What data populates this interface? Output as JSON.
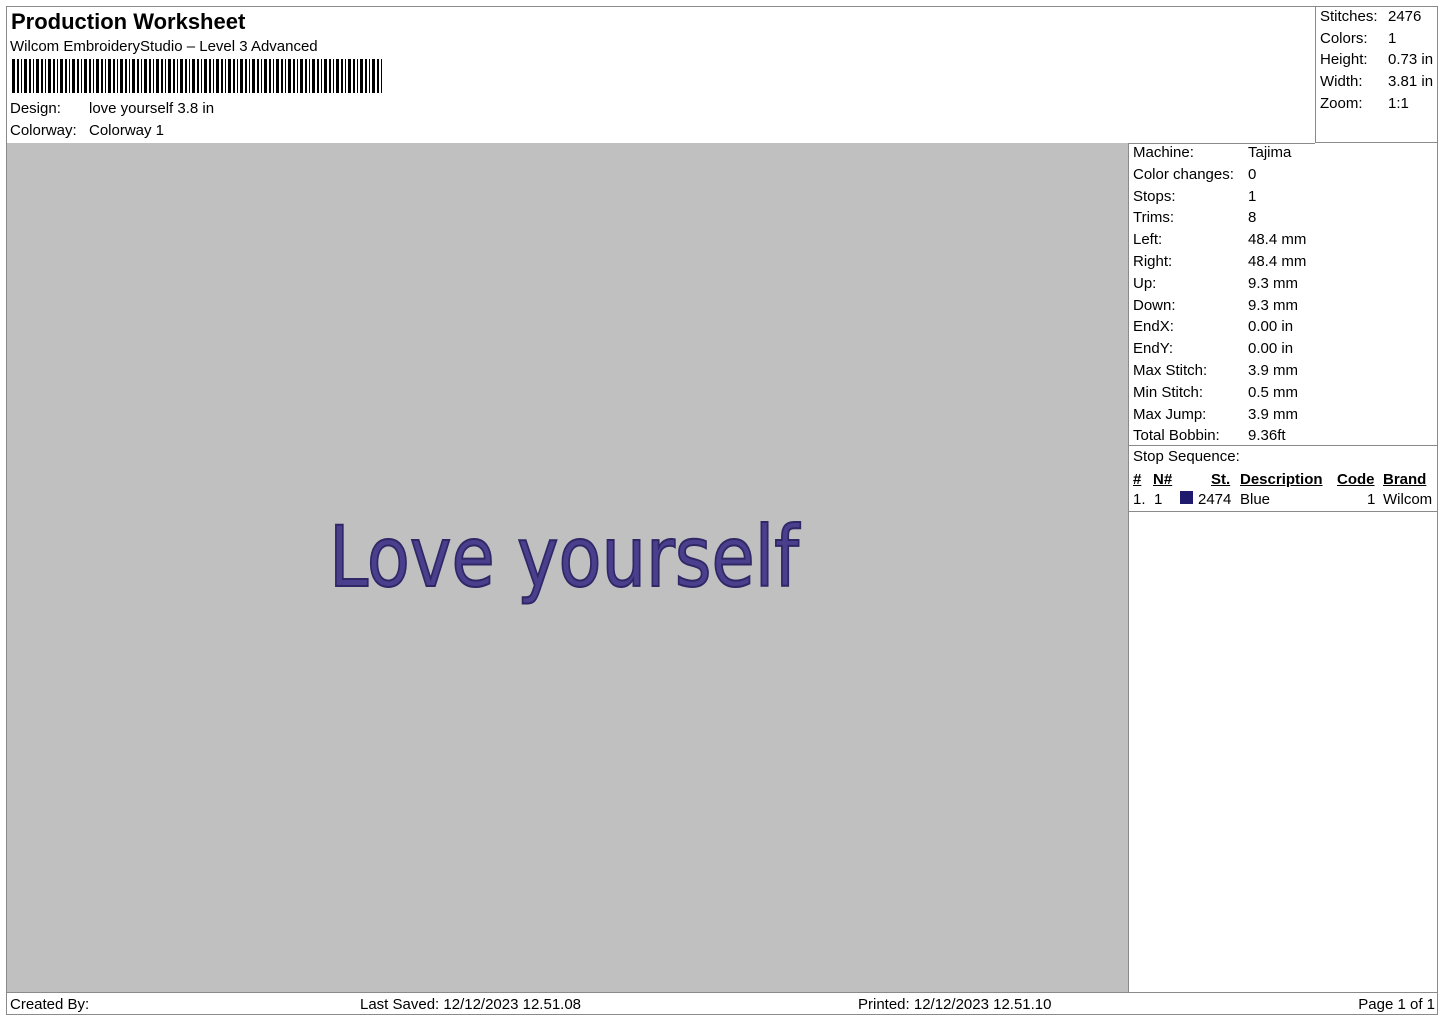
{
  "header": {
    "title": "Production Worksheet",
    "subtitle": "Wilcom EmbroideryStudio – Level 3 Advanced",
    "design_label": "Design:",
    "design_value": "love yourself 3.8 in",
    "colorway_label": "Colorway:",
    "colorway_value": "Colorway 1"
  },
  "summary": {
    "stitches_label": "Stitches:",
    "stitches_value": "2476",
    "colors_label": "Colors:",
    "colors_value": "1",
    "height_label": "Height:",
    "height_value": "0.73 in",
    "width_label": "Width:",
    "width_value": "3.81 in",
    "zoom_label": "Zoom:",
    "zoom_value": "1:1"
  },
  "properties": [
    {
      "label": "Machine:",
      "value": "Tajima"
    },
    {
      "label": "Color changes:",
      "value": "0"
    },
    {
      "label": "Stops:",
      "value": "1"
    },
    {
      "label": "Trims:",
      "value": "8"
    },
    {
      "label": "Left:",
      "value": "48.4 mm"
    },
    {
      "label": "Right:",
      "value": "48.4 mm"
    },
    {
      "label": "Up:",
      "value": "9.3 mm"
    },
    {
      "label": "Down:",
      "value": "9.3 mm"
    },
    {
      "label": "EndX:",
      "value": "0.00 in"
    },
    {
      "label": "EndY:",
      "value": "0.00 in"
    },
    {
      "label": "Max Stitch:",
      "value": "3.9 mm"
    },
    {
      "label": "Min Stitch:",
      "value": "0.5 mm"
    },
    {
      "label": "Max Jump:",
      "value": "3.9 mm"
    },
    {
      "label": "Total Bobbin:",
      "value": "9.36ft"
    }
  ],
  "stop_sequence": {
    "title": "Stop Sequence:",
    "headers": {
      "num": "#",
      "n": "N#",
      "st": "St.",
      "description": "Description",
      "code": "Code",
      "brand": "Brand"
    },
    "rows": [
      {
        "num": "1.",
        "n": "1",
        "swatch_color": "#1f1a6e",
        "st": "2474",
        "description": "Blue",
        "code": "1",
        "brand": "Wilcom"
      }
    ]
  },
  "design_preview": {
    "text": "Love yourself",
    "thread_color": "#4a3f8c",
    "background_color": "#c0c0c0"
  },
  "footer": {
    "created_by": "Created By:",
    "last_saved": "Last Saved: 12/12/2023 12.51.08",
    "printed": "Printed: 12/12/2023 12.51.10",
    "page": "Page 1 of 1"
  }
}
